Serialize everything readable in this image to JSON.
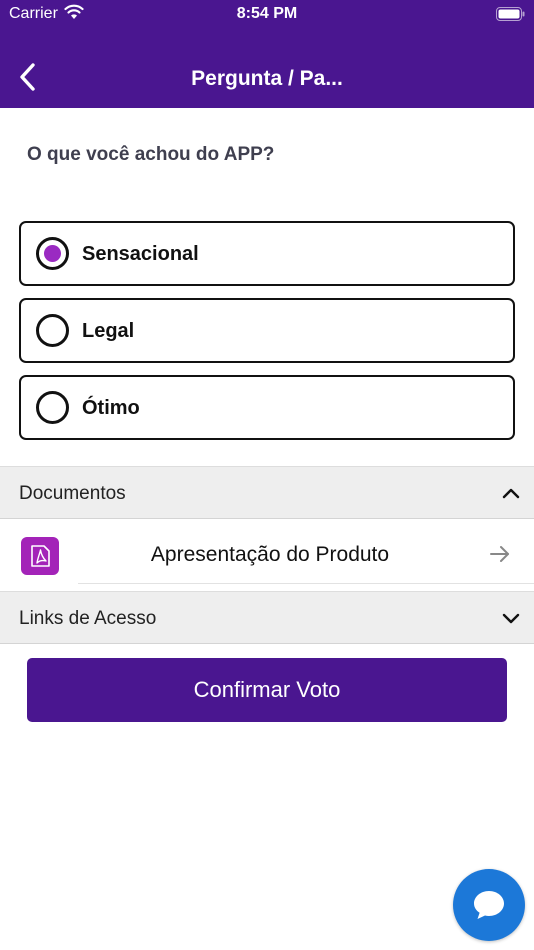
{
  "status_bar": {
    "carrier": "Carrier",
    "time": "8:54 PM"
  },
  "nav": {
    "title": "Pergunta / Pa...",
    "back_icon": "chevron-left-icon"
  },
  "question": "O que você achou do APP?",
  "options": [
    {
      "label": "Sensacional",
      "selected": true
    },
    {
      "label": "Legal",
      "selected": false
    },
    {
      "label": "Ótimo",
      "selected": false
    }
  ],
  "documents": {
    "title": "Documentos",
    "expanded": true,
    "items": [
      {
        "label": "Apresentação do Produto",
        "icon": "pdf-icon"
      }
    ]
  },
  "links": {
    "title": "Links de Acesso",
    "expanded": false
  },
  "confirm_label": "Confirmar Voto",
  "colors": {
    "primary": "#4a1690",
    "accent": "#9a2ac2",
    "chat": "#1c78d8"
  }
}
